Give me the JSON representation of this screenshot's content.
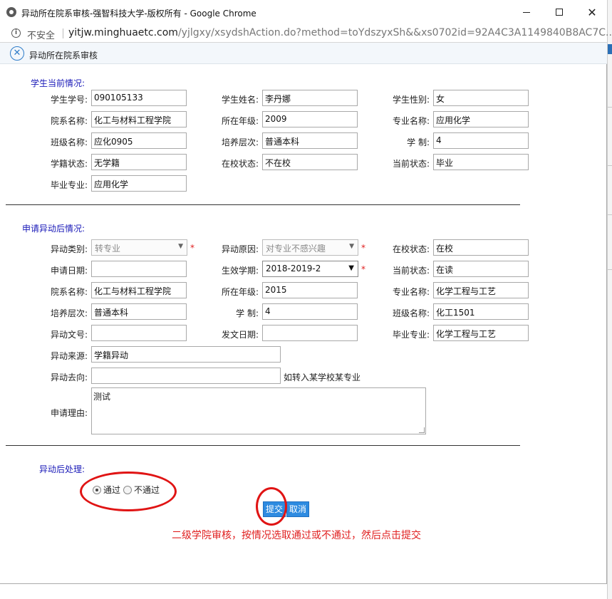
{
  "window": {
    "title": "异动所在院系审核-强智科技大学-版权所有 - Google Chrome",
    "min_glyph": "—",
    "close_glyph": "✕"
  },
  "address": {
    "security_label": "不安全",
    "host": "yitjw.minghuaetc.com",
    "path": "/yjlgxy/xsydshAction.do?method=toYdszyxSh&&xs0702id=92A4C3A1149840B8AC7C..."
  },
  "dialog": {
    "title": "异动所在院系审核"
  },
  "current": {
    "section_title": "学生当前情况:",
    "fields": {
      "student_id": {
        "label": "学生学号:",
        "value": "090105133"
      },
      "name": {
        "label": "学生姓名:",
        "value": "李丹娜"
      },
      "gender": {
        "label": "学生性别:",
        "value": "女"
      },
      "dept": {
        "label": "院系名称:",
        "value": "化工与材料工程学院"
      },
      "grade": {
        "label": "所在年级:",
        "value": "2009"
      },
      "major": {
        "label": "专业名称:",
        "value": "应用化学"
      },
      "class": {
        "label": "班级名称:",
        "value": "应化0905"
      },
      "level": {
        "label": "培养层次:",
        "value": "普通本科"
      },
      "years": {
        "label": "学 制:",
        "value": "4"
      },
      "status": {
        "label": "学籍状态:",
        "value": "无学籍"
      },
      "in_school": {
        "label": "在校状态:",
        "value": "不在校"
      },
      "current_status": {
        "label": "当前状态:",
        "value": "毕业"
      },
      "grad_major": {
        "label": "毕业专业:",
        "value": "应用化学"
      }
    }
  },
  "after": {
    "section_title": "申请异动后情况:",
    "fields": {
      "type": {
        "label": "异动类别:",
        "value": "转专业"
      },
      "reason": {
        "label": "异动原因:",
        "value": "对专业不感兴趣"
      },
      "in_school": {
        "label": "在校状态:",
        "value": "在校"
      },
      "apply_date": {
        "label": "申请日期:",
        "value": ""
      },
      "term": {
        "label": "生效学期:",
        "value": "2018-2019-2"
      },
      "current_status": {
        "label": "当前状态:",
        "value": "在读"
      },
      "dept": {
        "label": "院系名称:",
        "value": "化工与材料工程学院"
      },
      "grade": {
        "label": "所在年级:",
        "value": "2015"
      },
      "major": {
        "label": "专业名称:",
        "value": "化学工程与工艺"
      },
      "level": {
        "label": "培养层次:",
        "value": "普通本科"
      },
      "years": {
        "label": "学 制:",
        "value": "4"
      },
      "class": {
        "label": "班级名称:",
        "value": "化工1501"
      },
      "doc_no": {
        "label": "异动文号:",
        "value": ""
      },
      "doc_date": {
        "label": "发文日期:",
        "value": ""
      },
      "grad_major": {
        "label": "毕业专业:",
        "value": "化学工程与工艺"
      },
      "source": {
        "label": "异动来源:",
        "value": "学籍异动"
      },
      "destination": {
        "label": "异动去向:",
        "value": ""
      },
      "destination_hint": "如转入某学校某专业",
      "reason_text": {
        "label": "申请理由:",
        "value": "测试"
      }
    },
    "required_mark": "*",
    "arrow_glyph": "▼"
  },
  "process": {
    "section_title": "异动后处理:",
    "options": [
      {
        "label": "通过",
        "checked": true
      },
      {
        "label": "不通过",
        "checked": false
      }
    ],
    "submit_label": "提交",
    "cancel_label": "取消"
  },
  "annotation": {
    "text": "二级学院审核，按情况选取通过或不通过，然后点击提交",
    "color": "#e02020"
  },
  "colors": {
    "section_title": "#1a1ab8",
    "button": "#2e8be0",
    "header_icon": "#2e7cc9"
  }
}
